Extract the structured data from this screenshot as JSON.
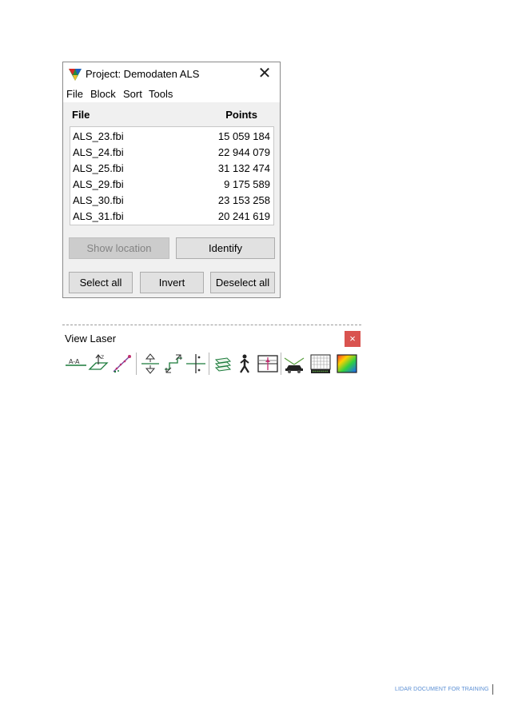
{
  "dialog": {
    "title": "Project: Demodaten ALS",
    "menu": [
      "File",
      "Block",
      "Sort",
      "Tools"
    ],
    "columns": {
      "file": "File",
      "points": "Points"
    },
    "rows": [
      {
        "file": "ALS_23.fbi",
        "points": "15 059 184"
      },
      {
        "file": "ALS_24.fbi",
        "points": "22 944 079"
      },
      {
        "file": "ALS_25.fbi",
        "points": "31 132 474"
      },
      {
        "file": "ALS_29.fbi",
        "points": "9 175 589"
      },
      {
        "file": "ALS_30.fbi",
        "points": "23 153 258"
      },
      {
        "file": "ALS_31.fbi",
        "points": "20 241 619"
      }
    ],
    "buttons": {
      "show_location": "Show location",
      "identify": "Identify",
      "select_all": "Select all",
      "invert": "Invert",
      "deselect_all": "Deselect all"
    },
    "close_glyph": "✕"
  },
  "toolbar": {
    "title": "View Laser",
    "close_glyph": "×",
    "tools": [
      "surface-line-icon",
      "height-cut-icon",
      "laser-line-icon",
      "up-down-arrows-icon",
      "shift-arrows-icon",
      "cross-section-icon",
      "layers-icon",
      "walker-icon",
      "section-view-icon",
      "vehicle-scan-icon",
      "grid-icon",
      "color-map-icon"
    ]
  },
  "footer": {
    "text": "LIDAR DOCUMENT FOR TRAINING"
  }
}
